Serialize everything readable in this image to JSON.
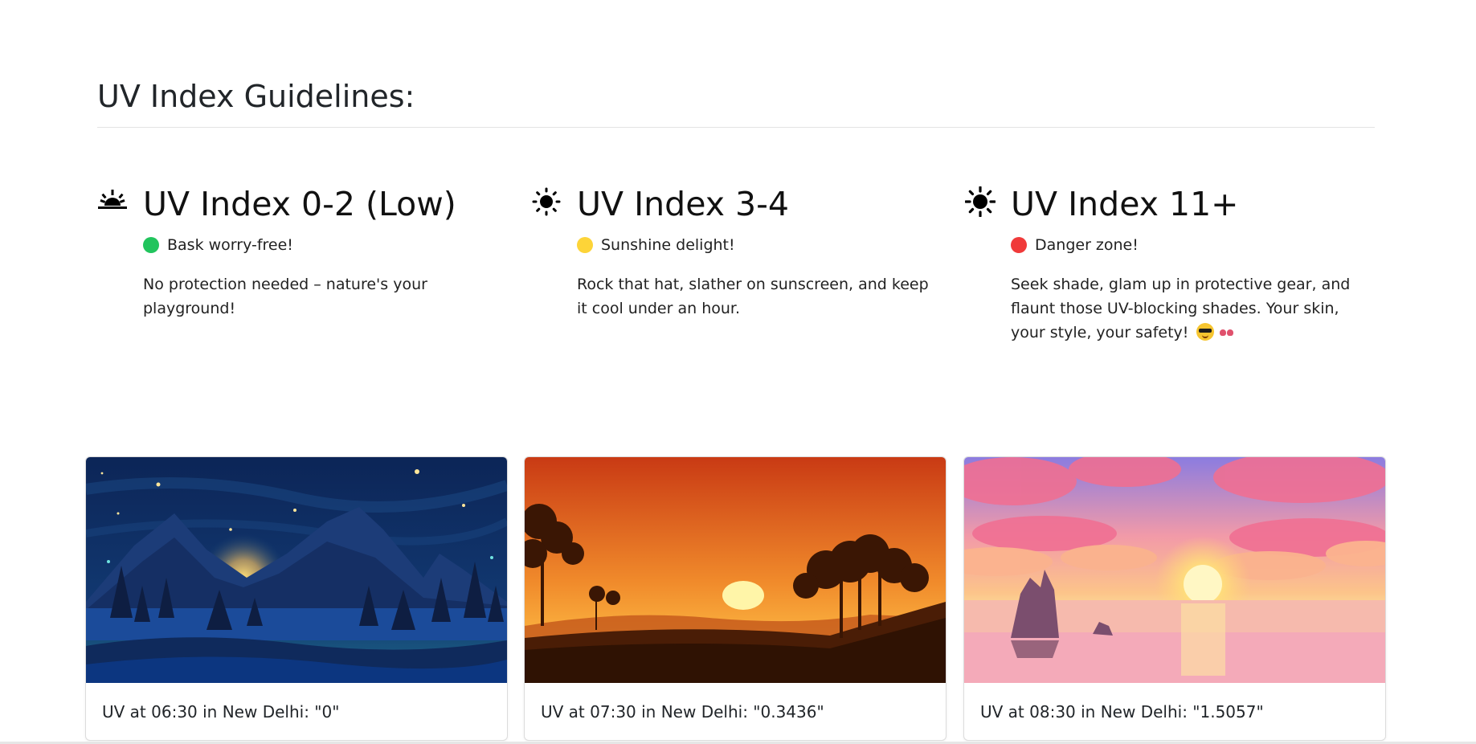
{
  "page": {
    "title": "UV Index Guidelines:"
  },
  "guidelines": [
    {
      "icon": "sunrise-icon",
      "heading": "UV Index 0-2 (Low)",
      "status_color": "#21c45d",
      "status": "Bask worry-free!",
      "description": "No protection needed – nature's your playground!"
    },
    {
      "icon": "sun-small-icon",
      "heading": "UV Index 3-4",
      "status_color": "#fdd438",
      "status": "Sunshine delight!",
      "description": "Rock that hat, slather on sunscreen, and keep it cool under an hour."
    },
    {
      "icon": "sun-large-icon",
      "heading": "UV Index 11+",
      "status_color": "#f03a3a",
      "status": "Danger zone!",
      "description": "Seek shade, glam up in protective gear, and flaunt those UV-blocking shades. Your skin, your style, your safety!"
    }
  ],
  "cards": [
    {
      "image": "night-mountain-lake-illustration",
      "caption": "UV at 06:30 in New Delhi: \"0\""
    },
    {
      "image": "orange-sunset-trees-illustration",
      "caption": "UV at 07:30 in New Delhi: \"0.3436\""
    },
    {
      "image": "pink-sky-sea-sunset-illustration",
      "caption": "UV at 08:30 in New Delhi: \"1.5057\""
    }
  ]
}
